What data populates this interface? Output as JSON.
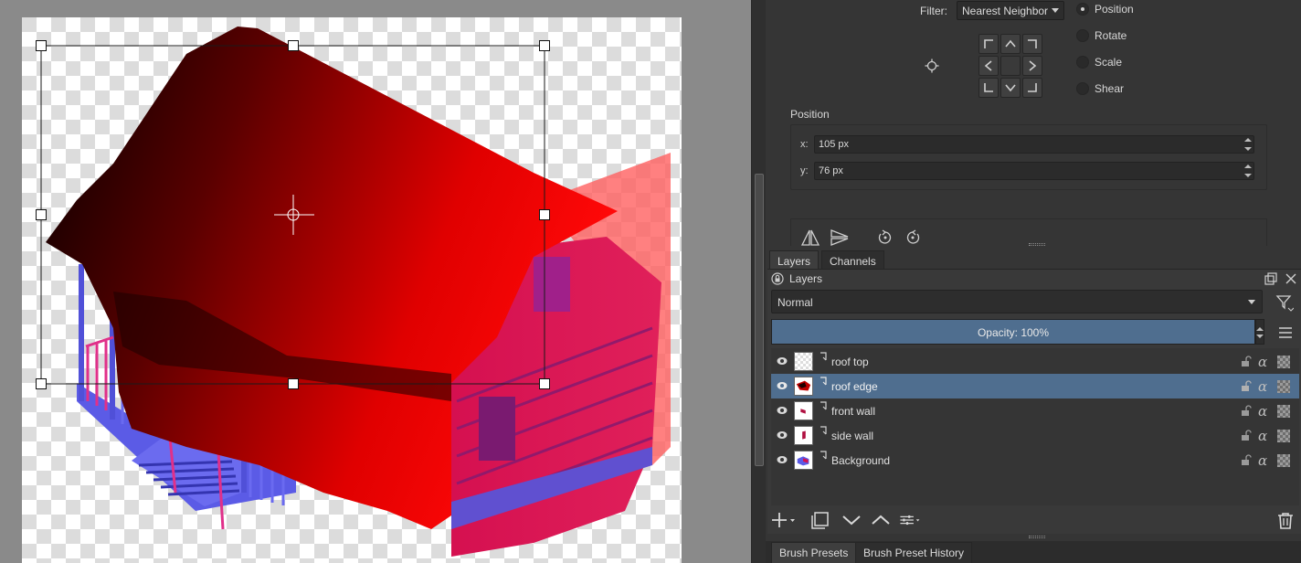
{
  "tool_options": {
    "filter_label": "Filter:",
    "filter_value": "Nearest Neighbor",
    "modes": [
      {
        "label": "Position",
        "selected": true
      },
      {
        "label": "Rotate",
        "selected": false
      },
      {
        "label": "Scale",
        "selected": false
      },
      {
        "label": "Shear",
        "selected": false
      }
    ],
    "position_title": "Position",
    "x_label": "x:",
    "x_value": "105 px",
    "y_label": "y:",
    "y_value": "76 px"
  },
  "layers_docker": {
    "tabs": [
      {
        "label": "Layers",
        "active": true
      },
      {
        "label": "Channels",
        "active": false
      }
    ],
    "title": "Layers",
    "blend_mode": "Normal",
    "opacity": "Opacity:  100%",
    "layers": [
      {
        "name": "roof top",
        "selected": false,
        "icon": "paint-layer-icon"
      },
      {
        "name": "roof edge",
        "selected": true,
        "icon": "paint-layer-icon"
      },
      {
        "name": "front wall",
        "selected": false,
        "icon": "paint-layer-icon"
      },
      {
        "name": "side wall",
        "selected": false,
        "icon": "paint-layer-icon"
      },
      {
        "name": "Background",
        "selected": false,
        "icon": "paint-layer-icon"
      }
    ]
  },
  "bottom_tabs": [
    {
      "label": "Brush Presets",
      "active": true
    },
    {
      "label": "Brush Preset History",
      "active": false
    }
  ],
  "colors": {
    "selection": "#4f6e8f",
    "panel": "#353535",
    "canvas_bg": "#8a8a8a"
  }
}
